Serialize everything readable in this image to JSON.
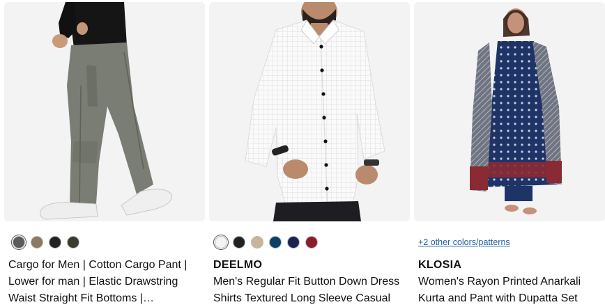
{
  "products": [
    {
      "brand": "",
      "colors": [
        "#5b5b5b",
        "#8a7a62",
        "#222222",
        "#3a3a2e"
      ],
      "title_lines": [
        "Cargo for Men | Cotton Cargo Pant |",
        "Lower for man | Elastic Drawstring",
        "Waist Straight Fit Bottoms |…"
      ]
    },
    {
      "brand": "DEELMO",
      "colors": [
        "#f4f4f6",
        "#222222",
        "#c9b49a",
        "#0e3f66",
        "#1c2350",
        "#8a1d2a"
      ],
      "title_lines": [
        "Men's Regular Fit Button Down Dress",
        "Shirts Textured Long Sleeve Casual"
      ]
    },
    {
      "brand": "KLOSIA",
      "more_colors_text": "+2 other colors/patterns",
      "title_lines": [
        "Women's Rayon Printed Anarkali",
        "Kurta and Pant with Dupatta Set"
      ]
    }
  ]
}
